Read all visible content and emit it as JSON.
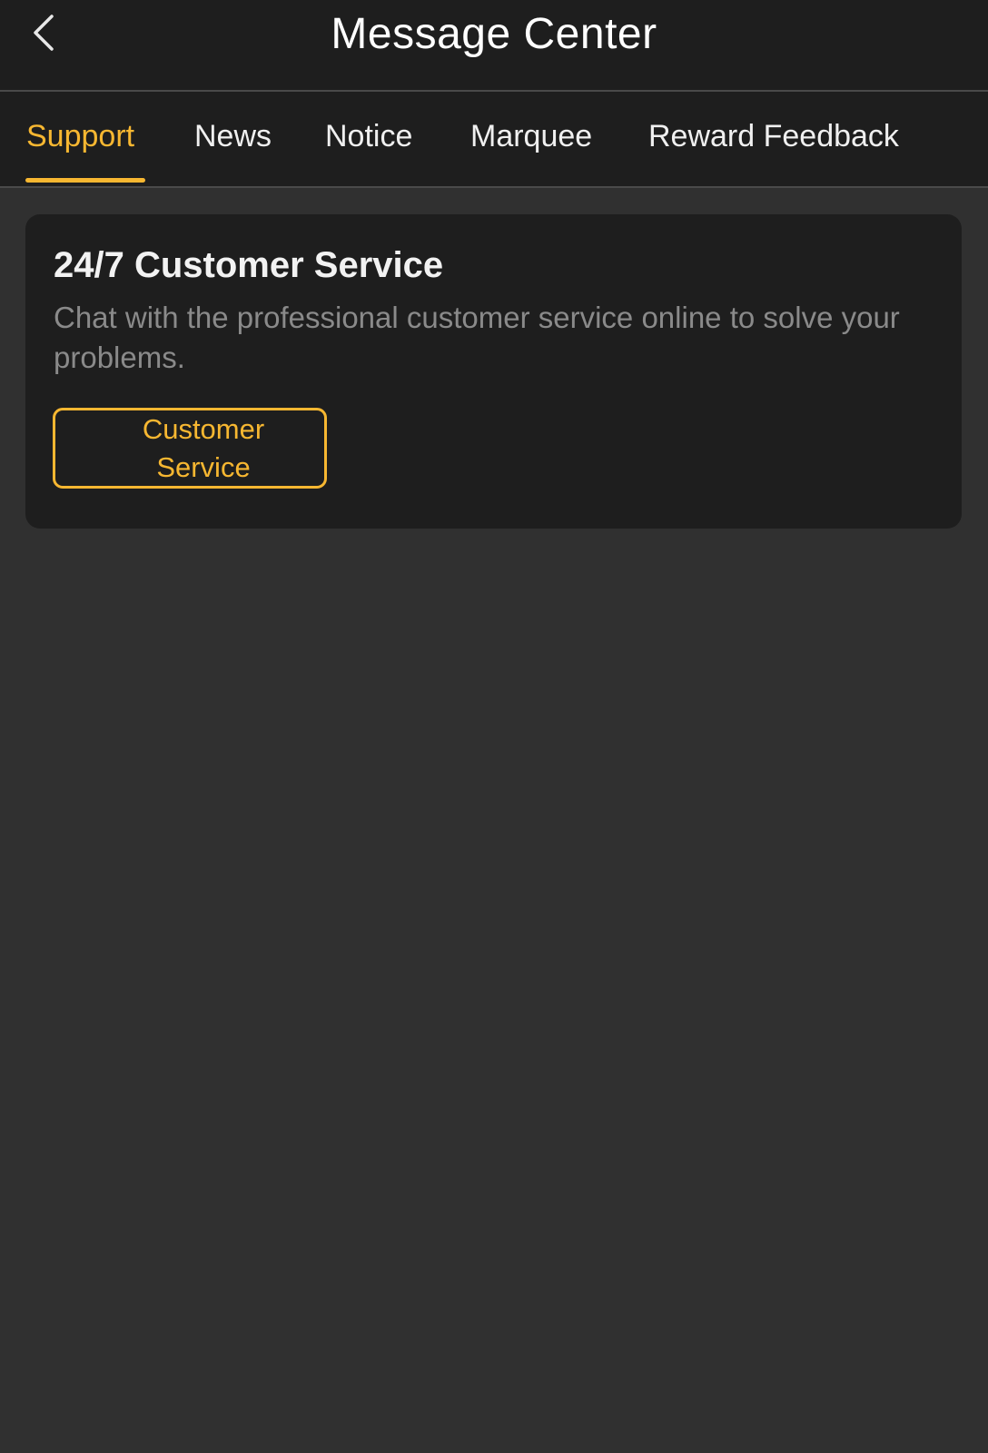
{
  "header": {
    "back_icon": "chevron-left-icon",
    "title": "Message Center"
  },
  "tabs": [
    {
      "label": "Support",
      "active": true
    },
    {
      "label": "News",
      "active": false
    },
    {
      "label": "Notice",
      "active": false
    },
    {
      "label": "Marquee",
      "active": false
    },
    {
      "label": "Reward Feedback",
      "active": false
    }
  ],
  "support_card": {
    "title": "24/7 Customer Service",
    "description": "Chat with the professional customer service online to solve your problems.",
    "button_label": "Customer Service"
  },
  "colors": {
    "accent": "#f7b731",
    "header_bg": "#1e1e1e",
    "page_bg": "#303030",
    "card_bg": "#1e1e1e"
  }
}
